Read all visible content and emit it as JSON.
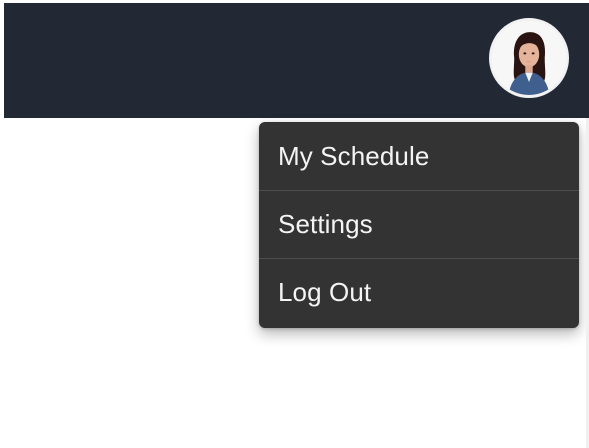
{
  "header": {
    "background_color": "#222935",
    "avatar": {
      "icon": "user-avatar",
      "description_label": "User profile photo"
    }
  },
  "user_menu": {
    "items": [
      {
        "label": "My Schedule"
      },
      {
        "label": "Settings"
      },
      {
        "label": "Log Out"
      }
    ],
    "background_color": "#333333",
    "text_color": "#f4f4f4"
  }
}
